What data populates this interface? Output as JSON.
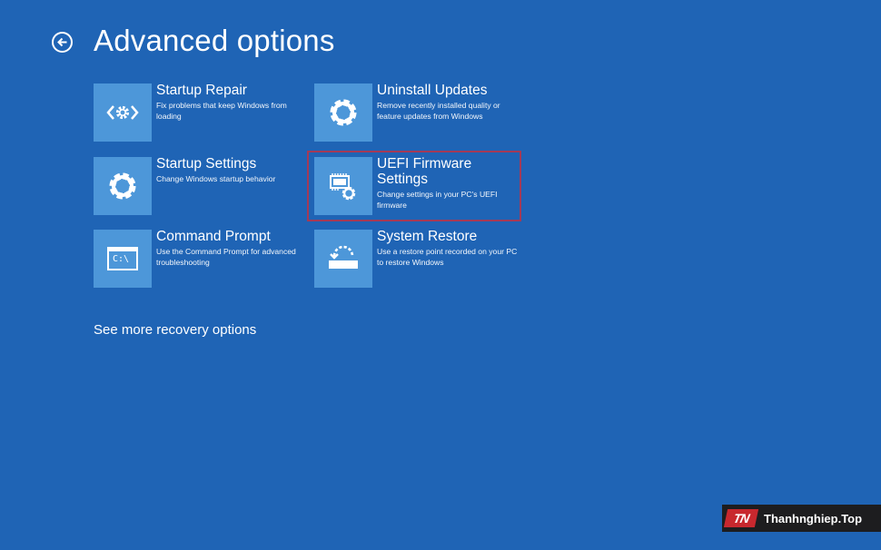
{
  "page": {
    "title": "Advanced options",
    "back_icon": "arrow-left-circle-icon",
    "more_link": "See more recovery options"
  },
  "options": [
    {
      "title": "Startup Repair",
      "desc": "Fix problems that keep Windows from loading",
      "icon": "startup-repair-icon"
    },
    {
      "title": "Uninstall Updates",
      "desc": "Remove recently installed quality or feature updates from Windows",
      "icon": "gear-icon"
    },
    {
      "title": "Startup Settings",
      "desc": "Change Windows startup behavior",
      "icon": "gear-icon"
    },
    {
      "title": "UEFI Firmware Settings",
      "desc": "Change settings in your PC's UEFI firmware",
      "icon": "firmware-chip-gear-icon",
      "highlighted": true
    },
    {
      "title": "Command Prompt",
      "desc": "Use the Command Prompt for advanced troubleshooting",
      "icon": "command-prompt-icon",
      "icon_text": "C:\\"
    },
    {
      "title": "System Restore",
      "desc": "Use a restore point recorded on your PC to restore Windows",
      "icon": "system-restore-icon"
    }
  ],
  "watermark": {
    "logo_text": "TN",
    "text": "Thanhnghiep.Top"
  },
  "colors": {
    "background": "#1f64b5",
    "tile": "#4d97d9",
    "highlight_border": "#a33a57",
    "text": "#ffffff"
  }
}
